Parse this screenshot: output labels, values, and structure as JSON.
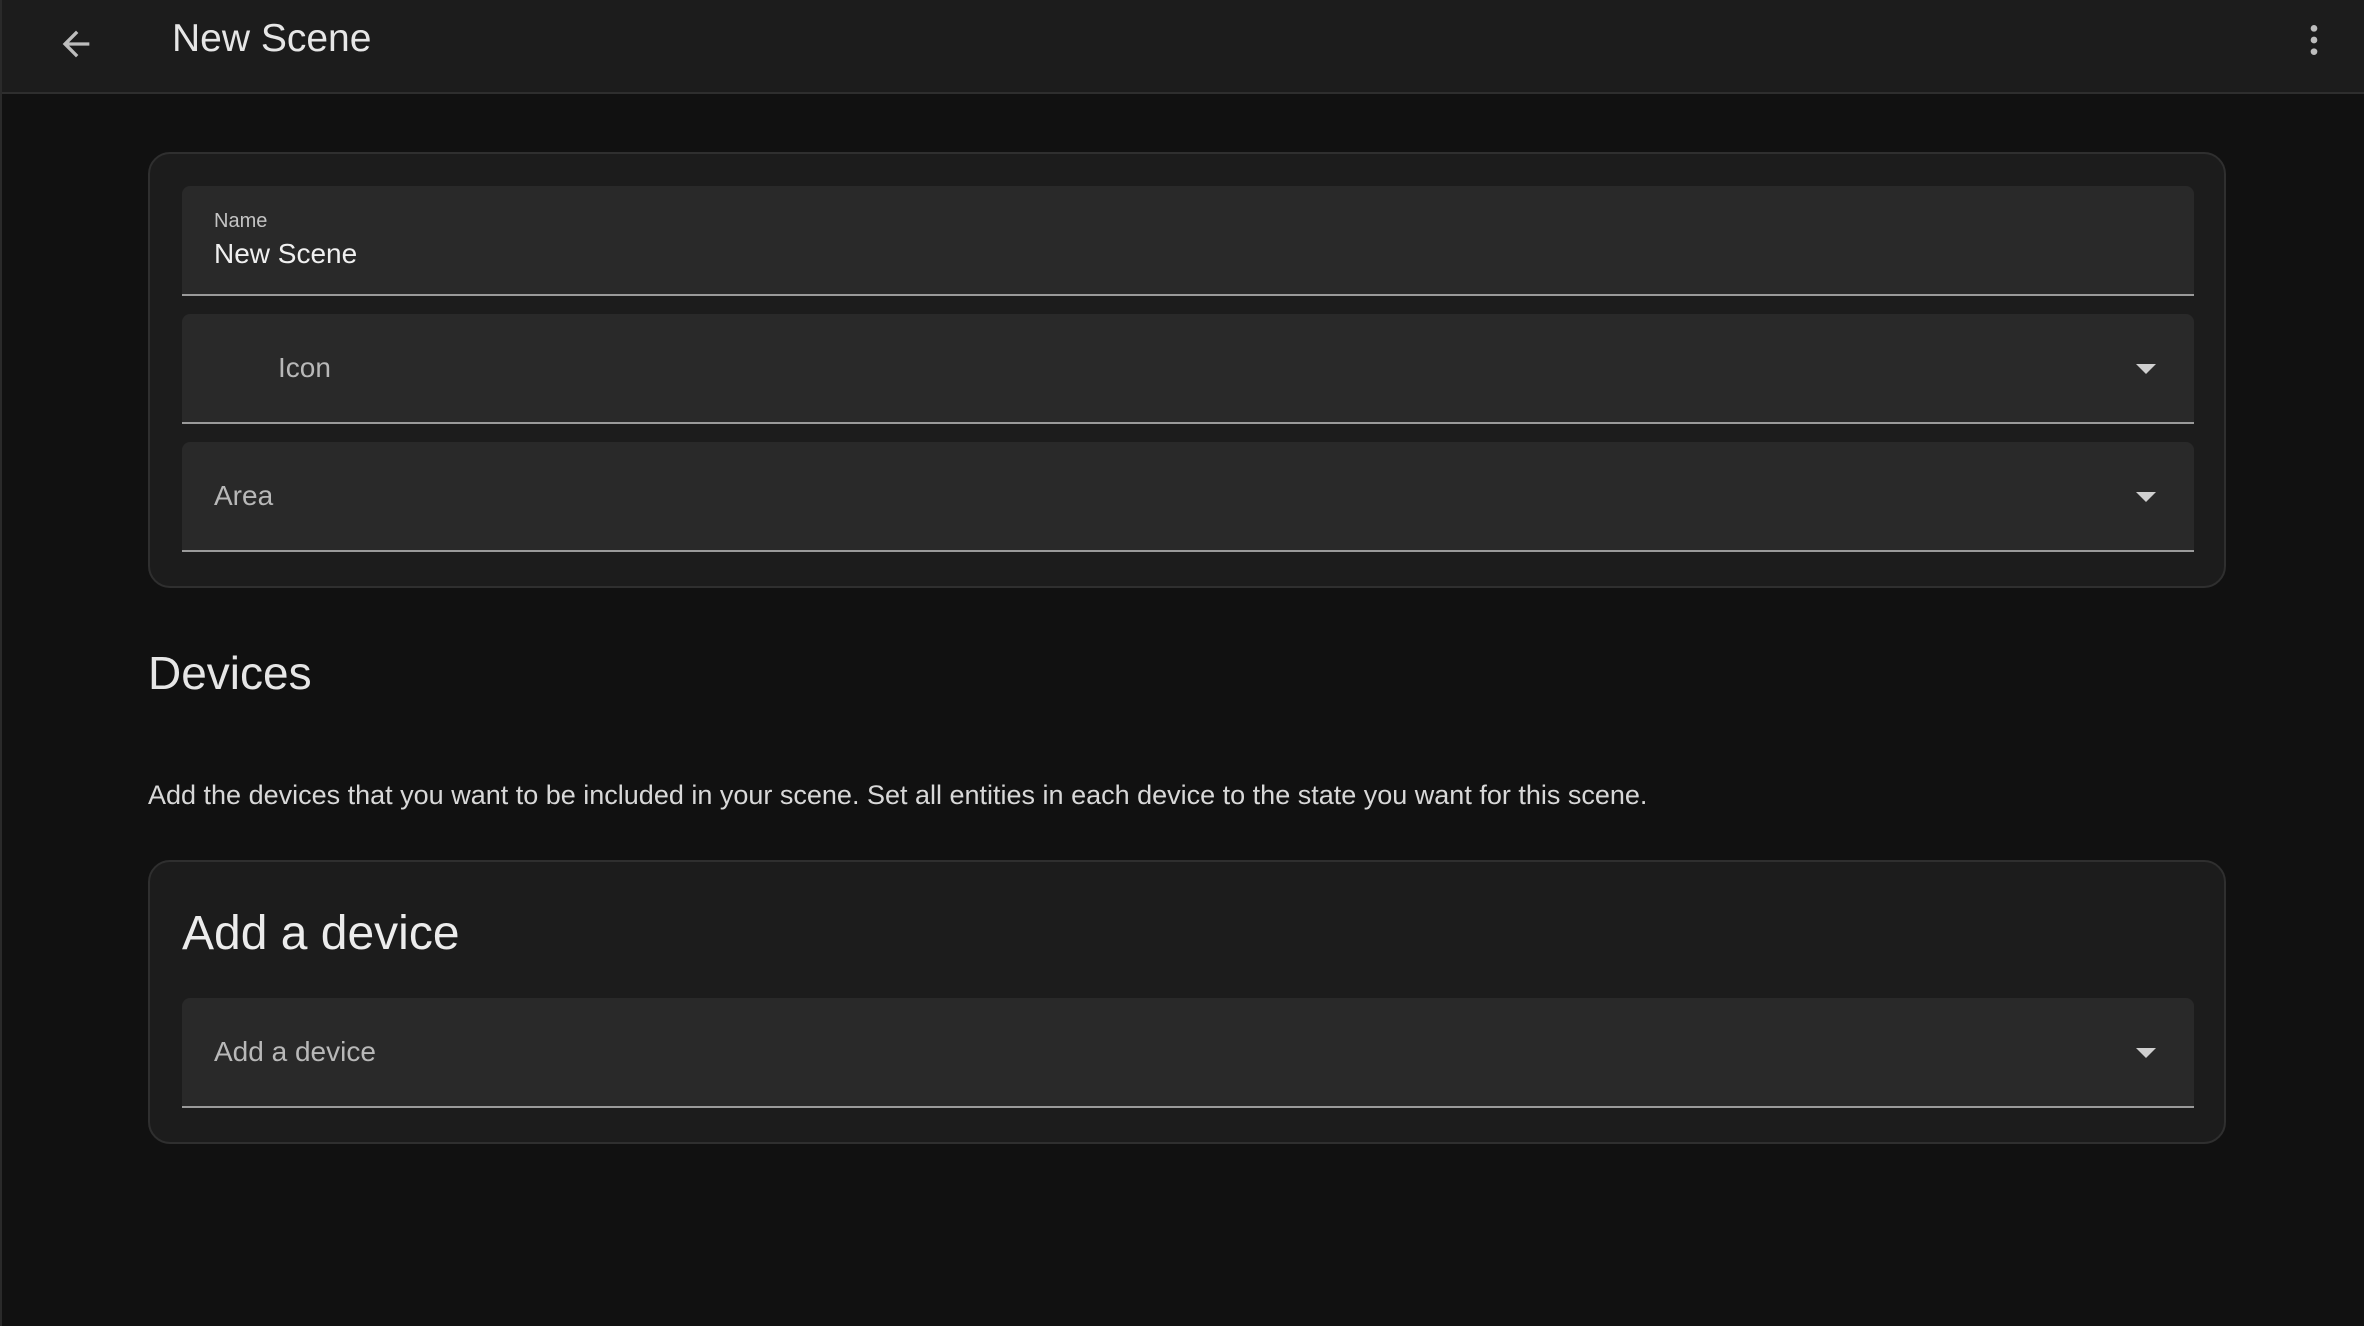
{
  "header": {
    "title": "New Scene",
    "back_icon": "arrow-left-icon",
    "menu_icon": "more-vertical-icon"
  },
  "details": {
    "name_label": "Name",
    "name_value": "New Scene",
    "icon_placeholder": "Icon",
    "area_placeholder": "Area"
  },
  "devices": {
    "title": "Devices",
    "description": "Add the devices that you want to be included in your scene. Set all entities in each device to the state you want for this scene.",
    "card_title": "Add a device",
    "picker_placeholder": "Add a device"
  },
  "colors": {
    "background": "#111111",
    "surface": "#1c1c1c",
    "field": "#292929"
  }
}
